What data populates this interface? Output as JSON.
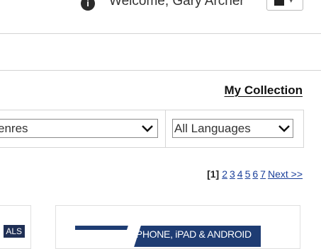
{
  "header": {
    "welcome_text": "Welcome, Gary Archer",
    "user_icon": "info-user-icon",
    "account_dropdown_icon": "chevron-down-icon"
  },
  "collection": {
    "label": "My Collection"
  },
  "filters": {
    "genres_value": "enres",
    "languages_value": "All Languages"
  },
  "pagination": {
    "current": "[1]",
    "pages": [
      "2",
      "3",
      "4",
      "5",
      "6",
      "7"
    ],
    "next": "Next >>"
  },
  "cards": [
    {
      "badge": "ALS"
    },
    {
      "banner_text": "iPHONE, iPAD & ANDROID"
    }
  ],
  "colors": {
    "link": "#1a3f9a",
    "banner": "#1e3c73"
  }
}
